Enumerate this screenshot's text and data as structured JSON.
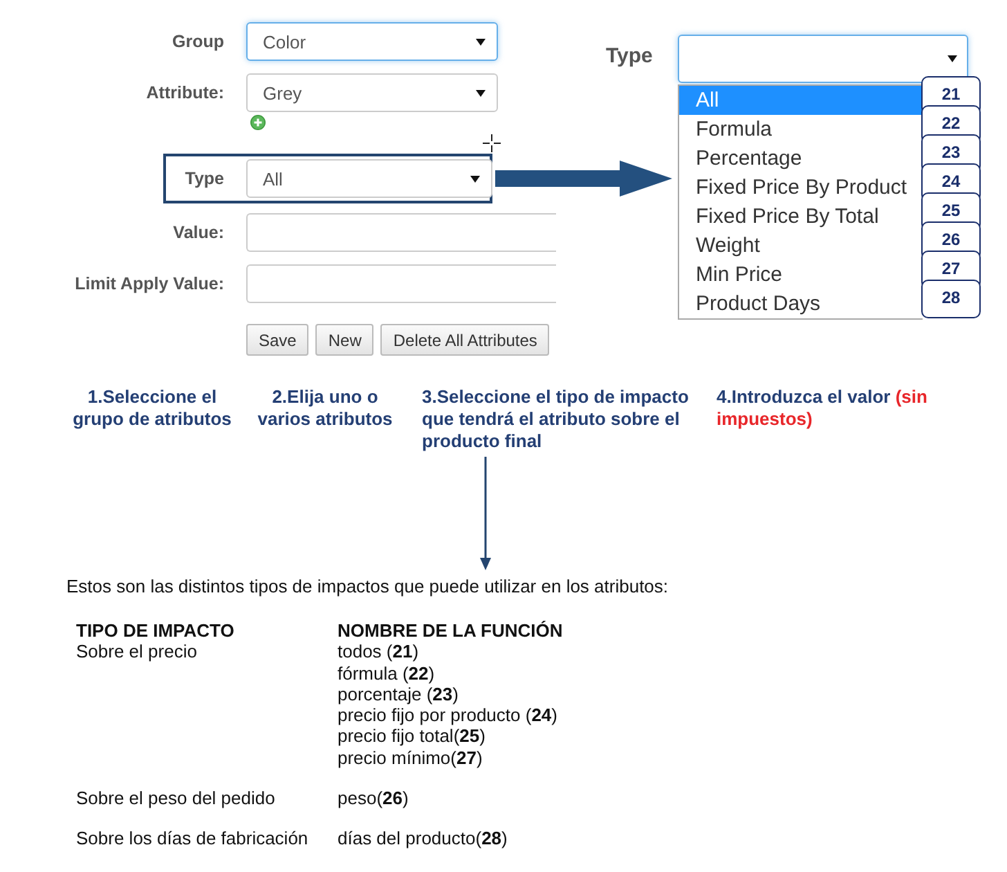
{
  "form": {
    "fields": [
      {
        "kind": "select",
        "label": "Group",
        "value": "Color",
        "focused": true,
        "highlighted": false,
        "add_button": false
      },
      {
        "kind": "select",
        "label": "Attribute:",
        "value": "Grey",
        "focused": false,
        "highlighted": false,
        "add_button": true
      },
      {
        "kind": "select",
        "label": "Type",
        "value": "All",
        "focused": false,
        "highlighted": true,
        "add_button": false
      },
      {
        "kind": "input",
        "label": "Value:",
        "focused": false,
        "highlighted": false,
        "add_button": false
      },
      {
        "kind": "input",
        "label": "Limit Apply Value:",
        "focused": false,
        "highlighted": false,
        "add_button": false
      }
    ],
    "buttons": [
      "Save",
      "New",
      "Delete All Attributes"
    ]
  },
  "type_dropdown": {
    "label": "Type",
    "focused": true,
    "options": [
      {
        "label": "All",
        "code": "21",
        "selected": true
      },
      {
        "label": "Formula",
        "code": "22",
        "selected": false
      },
      {
        "label": "Percentage",
        "code": "23",
        "selected": false
      },
      {
        "label": "Fixed Price By Product",
        "code": "24",
        "selected": false
      },
      {
        "label": "Fixed Price By Total",
        "code": "25",
        "selected": false
      },
      {
        "label": "Weight",
        "code": "26",
        "selected": false
      },
      {
        "label": "Min Price",
        "code": "27",
        "selected": false
      },
      {
        "label": "Product Days",
        "code": "28",
        "selected": false
      }
    ]
  },
  "steps": [
    {
      "text": "1.Seleccione el grupo de atributos"
    },
    {
      "text": "2.Elija uno o varios atributos"
    },
    {
      "text": "3.Seleccione el tipo de impacto que tendrá el atributo sobre el producto final"
    },
    {
      "text": "4.Introduzca el valor",
      "note": "(sin impuestos)"
    }
  ],
  "intro": "Estos son las distintos tipos de impactos que puede utilizar en los atributos:",
  "table": {
    "columns": [
      "TIPO DE IMPACTO",
      "NOMBRE DE LA FUNCIÓN"
    ],
    "rows": [
      {
        "impact": "Sobre el precio",
        "functions": [
          "todos (**21**)",
          "fórmula (**22**)",
          "porcentaje (**23**)",
          "precio fijo por producto (**24**)",
          "precio fijo total(**25**)",
          "precio mínimo(**27**)"
        ]
      },
      {
        "impact": "Sobre el peso del pedido",
        "functions": [
          "peso(**26**)"
        ]
      },
      {
        "impact": "Sobre los días de fabricación",
        "functions": [
          "días del producto(**28**)"
        ]
      }
    ]
  }
}
